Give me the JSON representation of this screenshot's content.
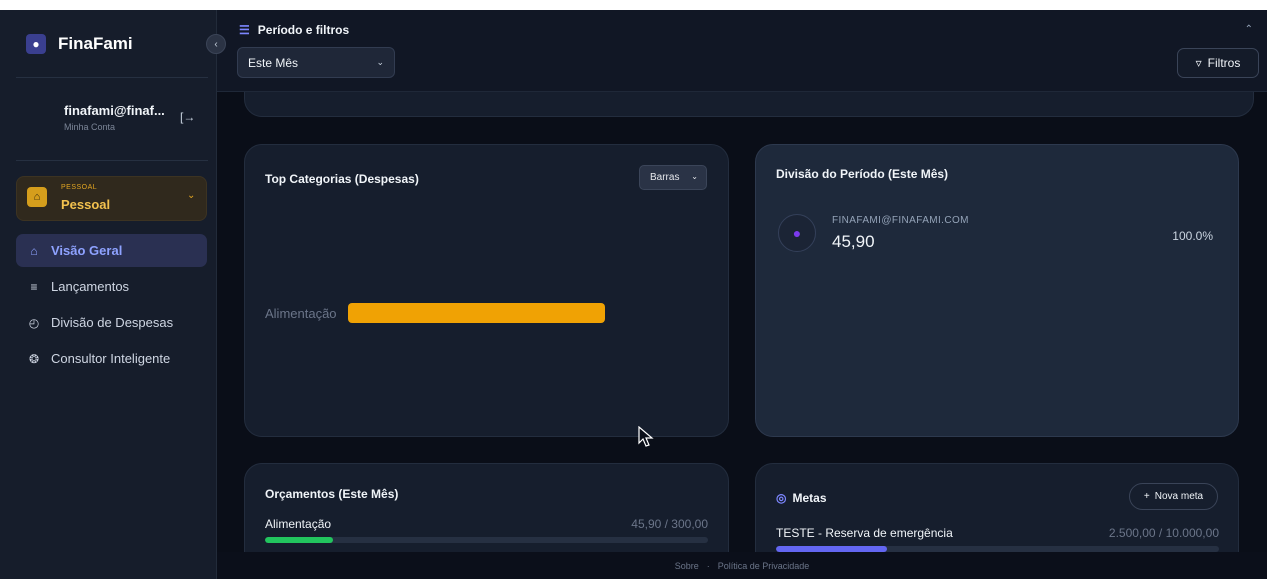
{
  "app": {
    "name": "FinaFami"
  },
  "account": {
    "email": "finafami@finaf...",
    "subtitle": "Minha Conta"
  },
  "profile": {
    "kicker": "PESSOAL",
    "name": "Pessoal"
  },
  "nav": [
    {
      "label": "Visão Geral",
      "icon": "home-icon",
      "active": true
    },
    {
      "label": "Lançamentos",
      "icon": "list-icon",
      "active": false
    },
    {
      "label": "Divisão de Despesas",
      "icon": "pie-chart-icon",
      "active": false
    },
    {
      "label": "Consultor Inteligente",
      "icon": "brain-icon",
      "active": false
    }
  ],
  "header": {
    "title": "Período e filtros",
    "period_value": "Este Mês",
    "filters_label": "Filtros"
  },
  "top_categories": {
    "title": "Top Categorias (Despesas)",
    "view_select": "Barras",
    "color": "#f0a204"
  },
  "chart_data": {
    "type": "bar",
    "categories": [
      "Alimentação"
    ],
    "values": [
      45.9
    ],
    "title": "Top Categorias (Despesas)",
    "xlabel": "",
    "ylabel": "",
    "grid": false
  },
  "division": {
    "title": "Divisão do Período (Este Mês)",
    "member_email": "FINAFAMI@FINAFAMI.COM",
    "amount": "45,90",
    "percent": "100.0%"
  },
  "budgets": {
    "title": "Orçamentos (Este Mês)",
    "items": [
      {
        "name": "Alimentação",
        "value": "45,90 / 300,00",
        "fraction": 0.153,
        "color": "#22c55e"
      }
    ]
  },
  "goals": {
    "title": "Metas",
    "new_button": "Nova meta",
    "items": [
      {
        "name": "TESTE - Reserva de emergência",
        "value": "2.500,00 / 10.000,00",
        "fraction": 0.25,
        "color": "#6366f1"
      }
    ]
  },
  "footer": {
    "about": "Sobre",
    "separator": "·",
    "privacy": "Política de Privacidade"
  }
}
